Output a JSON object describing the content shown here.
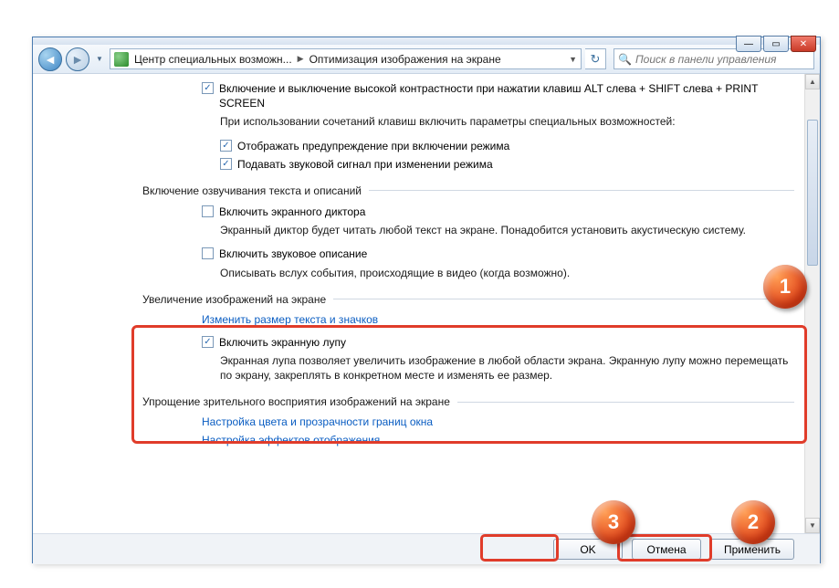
{
  "window_controls": {
    "min": "—",
    "max": "▭",
    "close": "✕"
  },
  "nav": {
    "crumb1": "Центр специальных возможн...",
    "crumb2": "Оптимизация изображения на экране",
    "search_placeholder": "Поиск в панели управления"
  },
  "opt1": {
    "label": "Включение и выключение высокой контрастности при нажатии клавиш ALT слева + SHIFT слева + PRINT SCREEN",
    "sublabel": "При использовании сочетаний клавиш включить параметры специальных возможностей:",
    "s1": "Отображать предупреждение при включении режима",
    "s2": "Подавать звуковой сигнал при изменении режима"
  },
  "sec_voice": {
    "title": "Включение озвучивания текста и описаний",
    "narr_label": "Включить экранного диктора",
    "narr_desc": "Экранный диктор будет читать любой текст на экране. Понадобится установить акустическую систему.",
    "audio_label": "Включить звуковое описание",
    "audio_desc": "Описывать вслух события, происходящие в видео (когда возможно)."
  },
  "sec_zoom": {
    "title": "Увеличение изображений на экране",
    "link": "Изменить размер текста и значков",
    "mag_label": "Включить экранную лупу",
    "mag_desc": "Экранная лупа позволяет увеличить изображение в любой области экрана. Экранную лупу можно перемещать по экрану, закреплять в конкретном месте и изменять ее размер."
  },
  "sec_simplify": {
    "title": "Упрощение зрительного восприятия изображений на экране",
    "link1": "Настройка цвета и прозрачности границ окна",
    "link2": "Настройка эффектов отображения"
  },
  "buttons": {
    "ok": "OK",
    "cancel": "Отмена",
    "apply": "Применить"
  },
  "markers": {
    "m1": "1",
    "m2": "2",
    "m3": "3"
  }
}
